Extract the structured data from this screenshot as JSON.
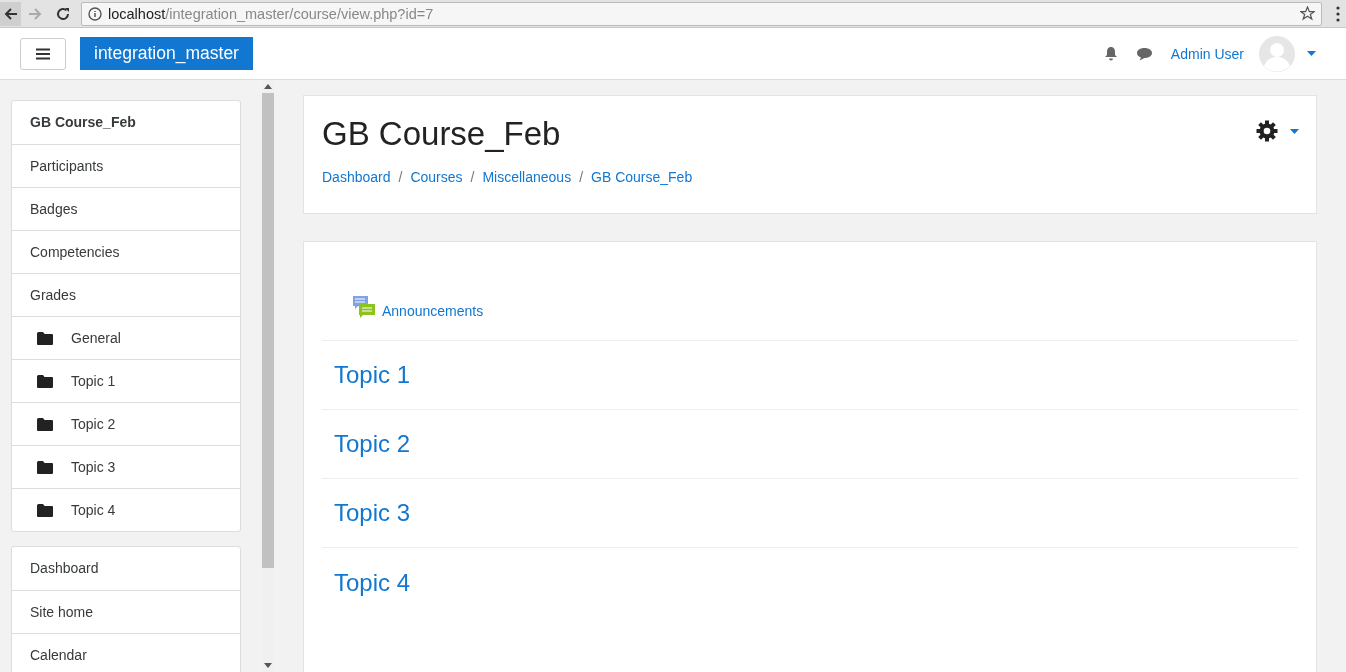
{
  "browser": {
    "url_host": "localhost",
    "url_path": "/integration_master/course/view.php?id=7"
  },
  "navbar": {
    "site_name": "integration_master",
    "user_name": "Admin User"
  },
  "sidebar": {
    "blocks": [
      {
        "items": [
          {
            "label": "GB Course_Feb",
            "kind": "header"
          },
          {
            "label": "Participants",
            "kind": "link"
          },
          {
            "label": "Badges",
            "kind": "link"
          },
          {
            "label": "Competencies",
            "kind": "link"
          },
          {
            "label": "Grades",
            "kind": "link"
          },
          {
            "label": "General",
            "kind": "folder"
          },
          {
            "label": "Topic 1",
            "kind": "folder"
          },
          {
            "label": "Topic 2",
            "kind": "folder"
          },
          {
            "label": "Topic 3",
            "kind": "folder"
          },
          {
            "label": "Topic 4",
            "kind": "folder"
          }
        ]
      },
      {
        "items": [
          {
            "label": "Dashboard",
            "kind": "link"
          },
          {
            "label": "Site home",
            "kind": "link"
          },
          {
            "label": "Calendar",
            "kind": "link"
          }
        ]
      }
    ]
  },
  "header": {
    "title": "GB Course_Feb",
    "breadcrumb": [
      "Dashboard",
      "Courses",
      "Miscellaneous",
      "GB Course_Feb"
    ],
    "breadcrumb_separator": "/"
  },
  "course": {
    "activity": "Announcements",
    "sections": [
      "Topic 1",
      "Topic 2",
      "Topic 3",
      "Topic 4"
    ]
  }
}
